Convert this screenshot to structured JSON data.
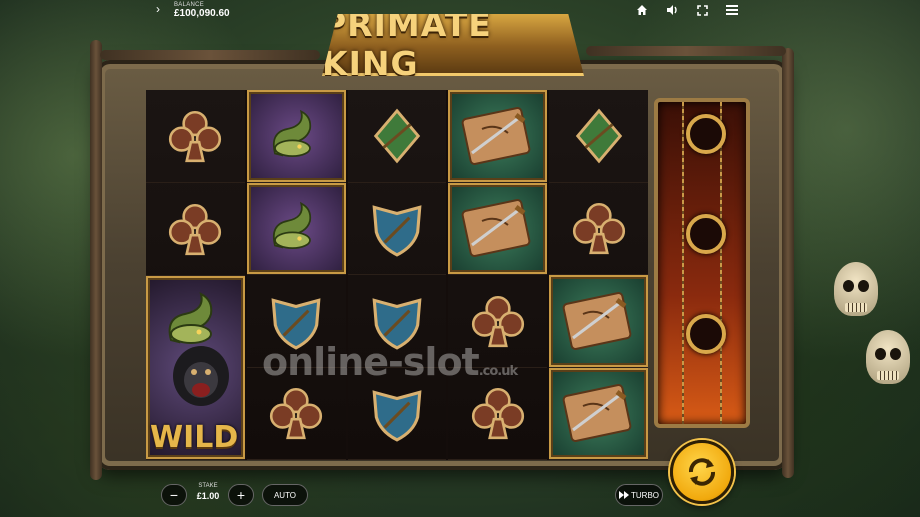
{
  "header": {
    "balance_label": "BALANCE",
    "balance_value": "£100,090.60",
    "icons": [
      "chevron-right-icon",
      "home-icon",
      "sound-icon",
      "fullscreen-icon",
      "menu-icon"
    ]
  },
  "game": {
    "title": "PRIMATE KING",
    "wild_label": "WILD",
    "reels": [
      [
        "club-wood",
        "club-wood",
        "snake-wild"
      ],
      [
        "snake",
        "snake",
        "blue-shield",
        "club-wood"
      ],
      [
        "green-diamond",
        "blue-shield",
        "blue-shield",
        "blue-shield"
      ],
      [
        "map-dagger",
        "map-dagger",
        "club-wood",
        "club-wood"
      ],
      [
        "green-diamond",
        "club-wood",
        "map-dagger",
        "map-dagger"
      ]
    ]
  },
  "controls": {
    "stake_label": "STAKE",
    "stake_value": "£1.00",
    "minus_label": "−",
    "plus_label": "+",
    "auto_label": "AUTO",
    "turbo_label": "TURBO"
  },
  "watermark": {
    "text": "online-slot",
    "suffix": ".co.uk"
  },
  "colors": {
    "accent_gold": "#e5b64a",
    "spin_button": "#f1a90d"
  }
}
